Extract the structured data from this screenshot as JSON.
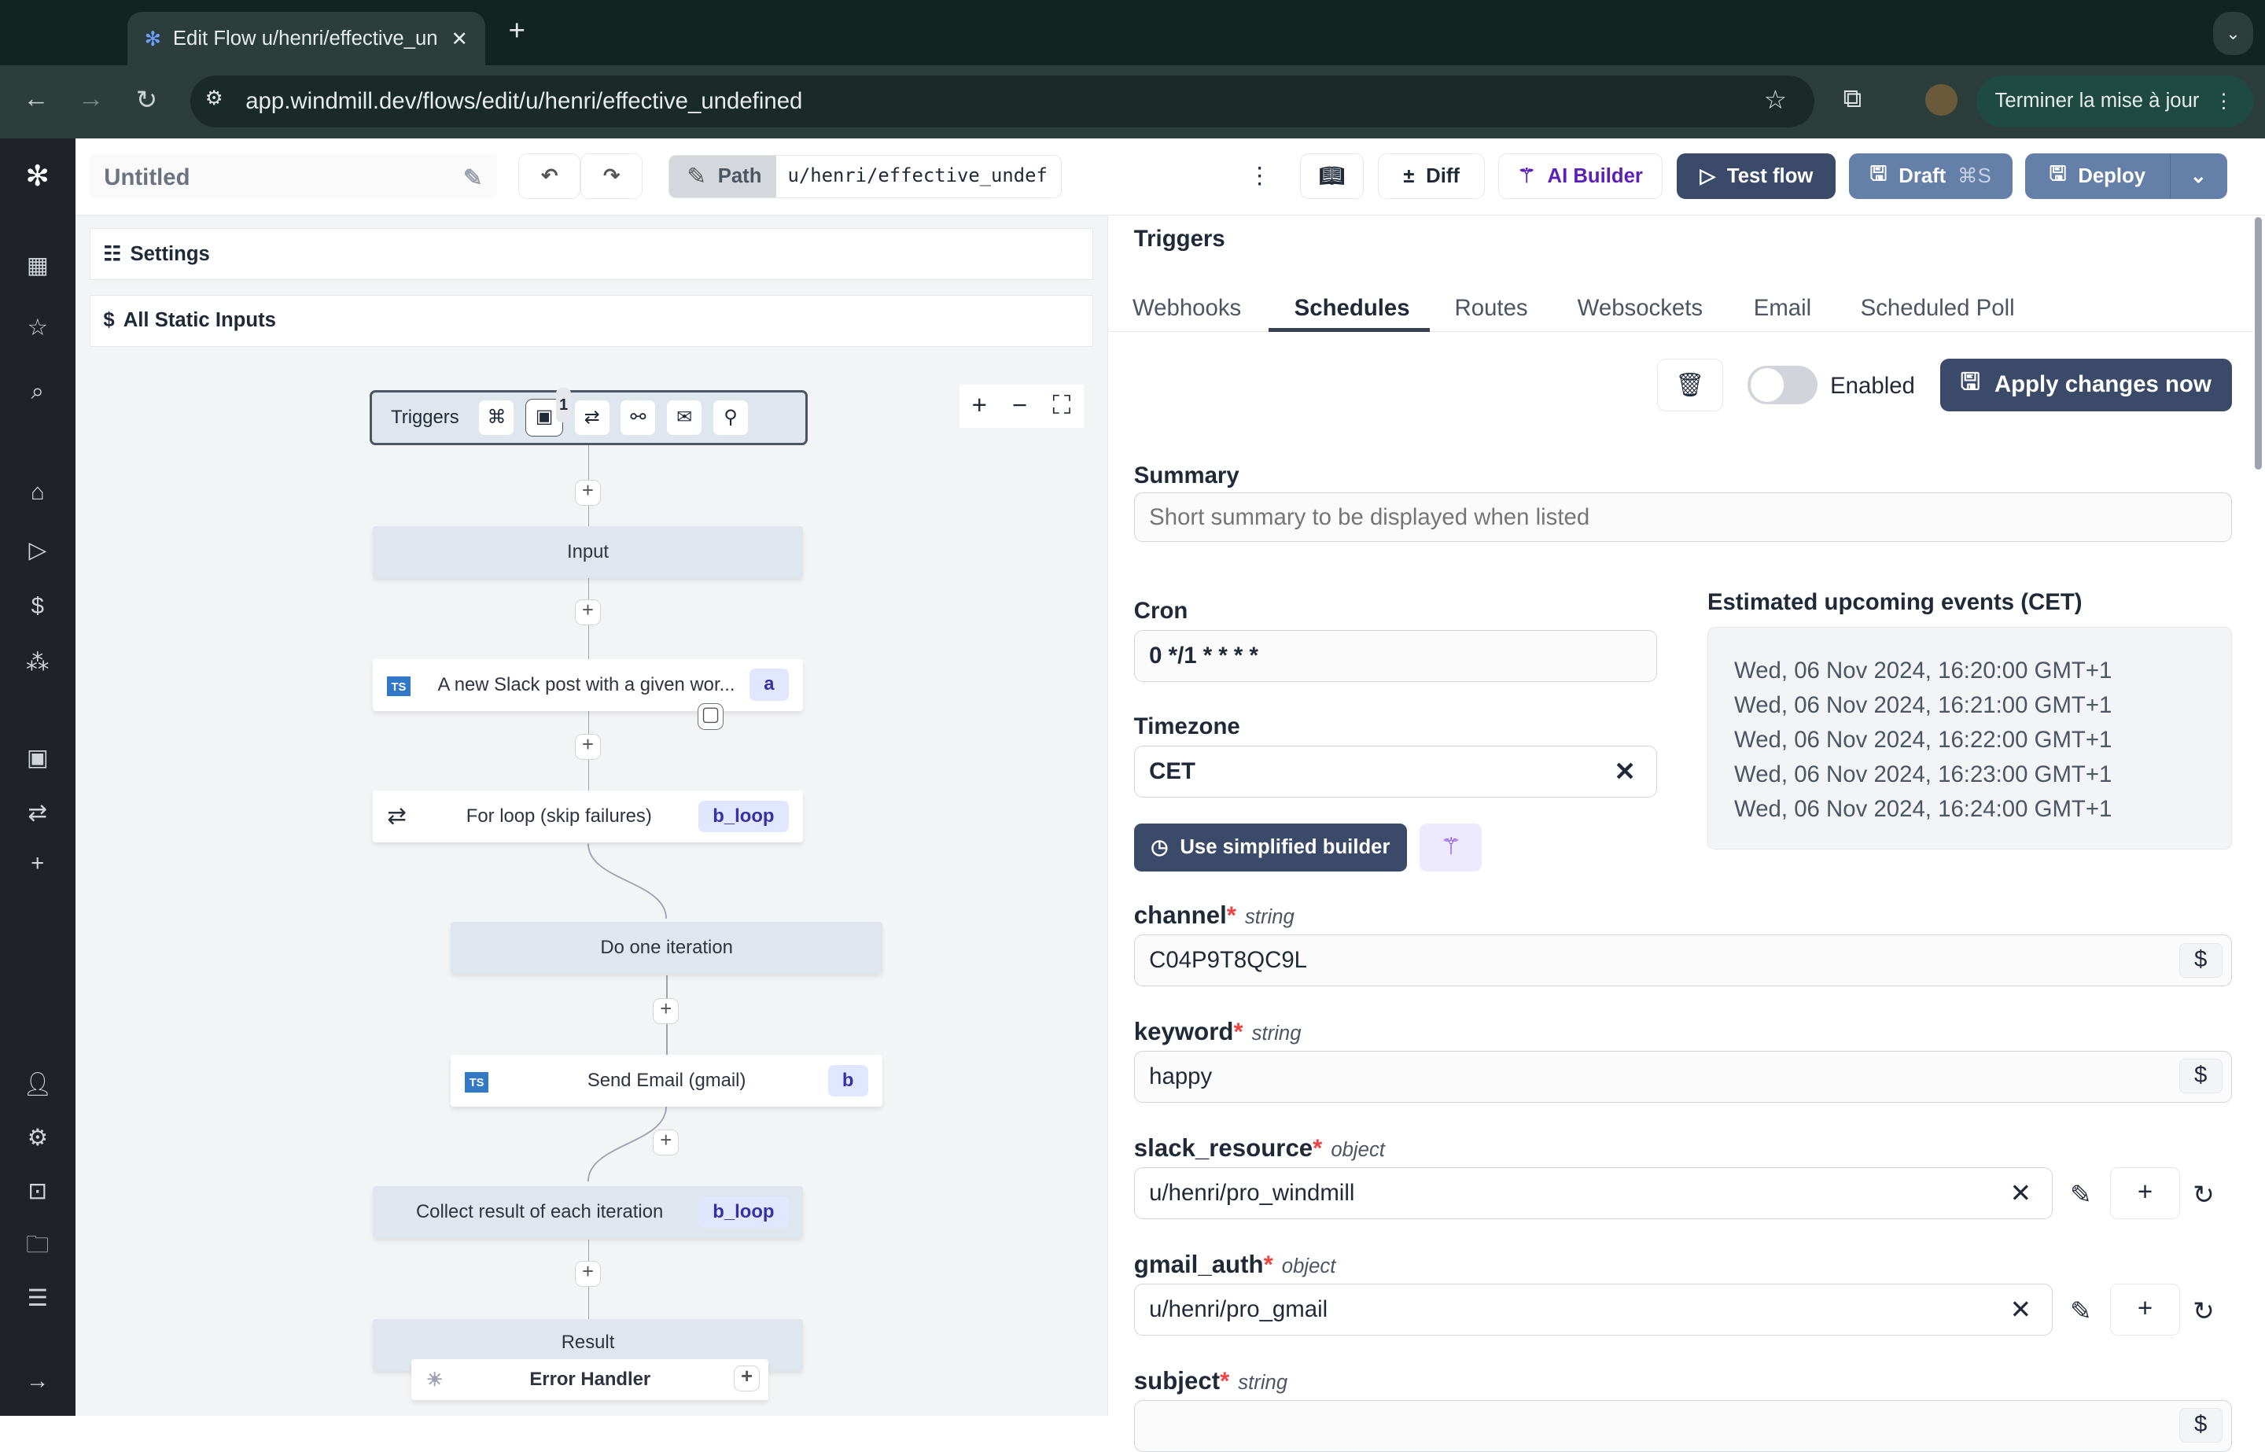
{
  "browser": {
    "tab_title": "Edit Flow u/henri/effective_un",
    "url": "app.windmill.dev/flows/edit/u/henri/effective_undefined",
    "update_button": "Terminer la mise à jour"
  },
  "header": {
    "flow_title": "Untitled",
    "path_label": "Path",
    "path_value": "u/henri/effective_undef",
    "diff": "Diff",
    "ai_builder": "AI Builder",
    "test_flow": "Test flow",
    "draft": "Draft",
    "draft_shortcut": "⌘S",
    "deploy": "Deploy"
  },
  "left": {
    "settings": "Settings",
    "static_inputs": "All Static Inputs"
  },
  "graph": {
    "triggers_label": "Triggers",
    "schedule_count": "1",
    "nodes": {
      "input": "Input",
      "slack": "A new Slack post with a given wor...",
      "slack_id": "a",
      "loop": "For loop (skip failures)",
      "loop_id": "b_loop",
      "iteration": "Do one iteration",
      "email": "Send Email (gmail)",
      "email_id": "b",
      "collect": "Collect result of each iteration",
      "collect_id": "b_loop",
      "result": "Result",
      "error_handler": "Error Handler"
    }
  },
  "triggers": {
    "title": "Triggers",
    "tabs": [
      "Webhooks",
      "Schedules",
      "Routes",
      "Websockets",
      "Email",
      "Scheduled Poll"
    ],
    "active_tab": "Schedules",
    "enabled_label": "Enabled",
    "enabled": false,
    "apply": "Apply changes now",
    "summary_label": "Summary",
    "summary_placeholder": "Short summary to be displayed when listed",
    "cron_label": "Cron",
    "cron_value": "0 */1 * * * *",
    "timezone_label": "Timezone",
    "timezone_value": "CET",
    "simplified_builder": "Use simplified builder",
    "upcoming_label": "Estimated upcoming events (CET)",
    "upcoming": [
      "Wed, 06 Nov 2024, 16:20:00 GMT+1",
      "Wed, 06 Nov 2024, 16:21:00 GMT+1",
      "Wed, 06 Nov 2024, 16:22:00 GMT+1",
      "Wed, 06 Nov 2024, 16:23:00 GMT+1",
      "Wed, 06 Nov 2024, 16:24:00 GMT+1"
    ],
    "args": [
      {
        "name": "channel",
        "type": "string",
        "value": "C04P9T8QC9L"
      },
      {
        "name": "keyword",
        "type": "string",
        "value": "happy"
      },
      {
        "name": "slack_resource",
        "type": "object",
        "value": "u/henri/pro_windmill"
      },
      {
        "name": "gmail_auth",
        "type": "object",
        "value": "u/henri/pro_gmail"
      },
      {
        "name": "subject",
        "type": "string",
        "value": ""
      }
    ]
  }
}
